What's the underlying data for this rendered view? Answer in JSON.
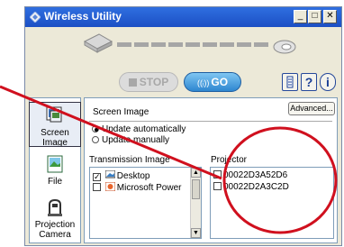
{
  "window": {
    "title": "Wireless Utility",
    "minimize_glyph": "_",
    "maximize_glyph": "□",
    "close_glyph": "✕"
  },
  "controls": {
    "stop_label": "STOP",
    "go_label": "GO",
    "go_icon_glyph": "((ᵢ))",
    "help_label": "?",
    "info_label": "i"
  },
  "nav": {
    "items": [
      {
        "label": "Screen Image",
        "selected": true,
        "icon": "screen-image-icon"
      },
      {
        "label": "File",
        "selected": false,
        "icon": "file-icon"
      },
      {
        "label": "Projection Camera",
        "selected": false,
        "icon": "projection-camera-icon"
      }
    ]
  },
  "panel": {
    "title": "Screen Image",
    "advanced_label": "Advanced...",
    "update_auto": "Update automatically",
    "update_manual": "Update manually",
    "update_mode": "auto",
    "transmission_label": "Transmission Image",
    "transmission_items": [
      {
        "label": "Desktop",
        "checked": true
      },
      {
        "label": "Microsoft Power",
        "checked": false
      }
    ],
    "projector_label": "Projector",
    "projectors": [
      {
        "id": "00022D3A52D6",
        "checked": false
      },
      {
        "id": "00022D2A3C2D",
        "checked": false
      }
    ]
  },
  "colors": {
    "titlebar": "#1c4fc4",
    "go_button": "#2e86d0",
    "annotation": "#d0101e"
  }
}
